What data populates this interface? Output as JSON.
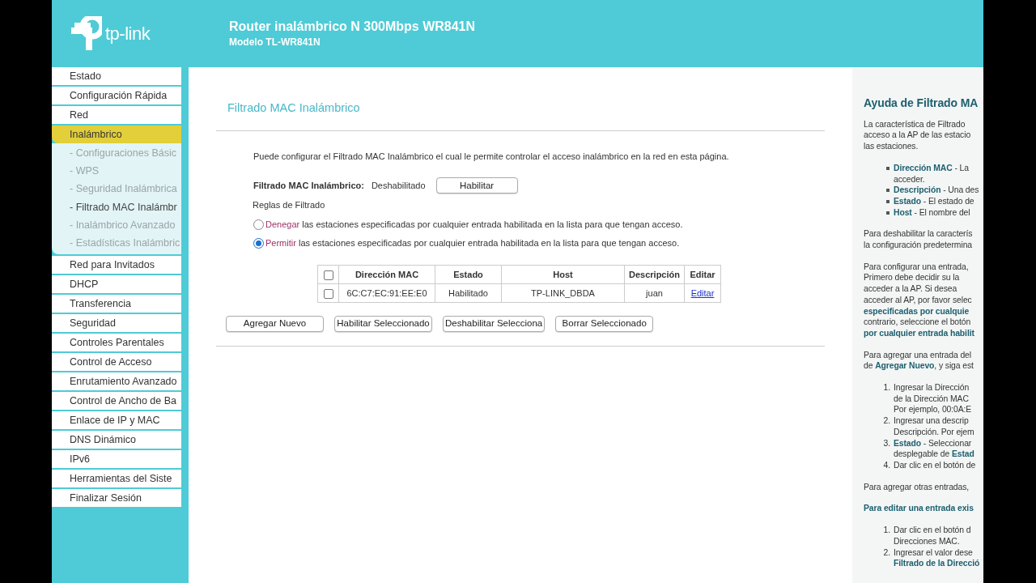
{
  "header": {
    "logo_text": "tp-link",
    "title": "Router inalámbrico N 300Mbps WR841N",
    "subtitle": "Modelo TL-WR841N"
  },
  "sidebar": {
    "items": [
      {
        "label": "Estado",
        "selected": false
      },
      {
        "label": "Configuración Rápida",
        "selected": false
      },
      {
        "label": "Red",
        "selected": false
      },
      {
        "label": "Inalámbrico",
        "selected": true,
        "children": [
          {
            "label": "- Configuraciones Básic",
            "selected": false
          },
          {
            "label": "- WPS",
            "selected": false
          },
          {
            "label": "- Seguridad Inalámbrica",
            "selected": false
          },
          {
            "label": "- Filtrado MAC Inalámbr",
            "selected": true
          },
          {
            "label": "- Inalámbrico Avanzado",
            "selected": false
          },
          {
            "label": "- Estadísticas Inalámbric",
            "selected": false
          }
        ]
      },
      {
        "label": "Red para Invitados",
        "selected": false
      },
      {
        "label": "DHCP",
        "selected": false
      },
      {
        "label": "Transferencia",
        "selected": false
      },
      {
        "label": "Seguridad",
        "selected": false
      },
      {
        "label": "Controles Parentales",
        "selected": false
      },
      {
        "label": "Control de Acceso",
        "selected": false
      },
      {
        "label": "Enrutamiento Avanzado",
        "selected": false
      },
      {
        "label": "Control de Ancho de Ba",
        "selected": false
      },
      {
        "label": "Enlace de IP y MAC",
        "selected": false
      },
      {
        "label": "DNS Dinámico",
        "selected": false
      },
      {
        "label": "IPv6",
        "selected": false
      },
      {
        "label": "Herramientas del Siste",
        "selected": false
      },
      {
        "label": "Finalizar Sesión",
        "selected": false
      }
    ]
  },
  "content": {
    "title": "Filtrado MAC Inalámbrico",
    "description": "Puede configurar el Filtrado MAC Inalámbrico el cual le permite controlar el acceso inalámbrico en la red en esta página.",
    "status": {
      "label": "Filtrado MAC Inalámbrico:",
      "value": "Deshabilitado",
      "button": "Habilitar"
    },
    "rules_label": "Reglas de Filtrado",
    "rules": [
      {
        "keyword": "Denegar",
        "text": "las estaciones especificadas por cualquier entrada habilitada en la lista para que tengan acceso.",
        "selected": false
      },
      {
        "keyword": "Permitir",
        "text": "las estaciones especificadas por cualquier entrada habilitada en la lista para que tengan acceso.",
        "selected": true
      }
    ],
    "table": {
      "select_all_checked": false,
      "columns": [
        "Dirección MAC",
        "Estado",
        "Host",
        "Descripción",
        "Editar"
      ],
      "rows": [
        {
          "checked": false,
          "mac": "6C:C7:EC:91:EE:E0",
          "estado": "Habilitado",
          "host": "TP-LINK_DBDA",
          "descripcion": "juan",
          "edit_link": "Editar"
        }
      ]
    },
    "buttons": [
      "Agregar Nuevo",
      "Habilitar Seleccionado",
      "Deshabilitar Selecciona",
      "Borrar Seleccionado"
    ]
  },
  "help": {
    "title": "Ayuda de Filtrado MA",
    "blocks": [
      {
        "kind": "p",
        "lines": [
          "La característica de Filtrado",
          "acceso a la AP de las estacio",
          "las estaciones."
        ]
      },
      {
        "kind": "ul",
        "items": [
          [
            "**Dirección MAC** - La",
            "acceder."
          ],
          [
            "**Descripción** - Una des"
          ],
          [
            "**Estado** - El estado de"
          ],
          [
            "**Host** - El nombre del"
          ]
        ]
      },
      {
        "kind": "p",
        "lines": [
          "Para deshabilitar la caracterís",
          "la configuración predetermina"
        ]
      },
      {
        "kind": "p",
        "lines": [
          "Para configurar una entrada,",
          "Primero debe decidir su la",
          "acceder a la AP. Si desea",
          "acceder al AP, por favor selec",
          "**especificadas por cualquie**",
          "contrario, seleccione el botón",
          "**por cualquier entrada habilit**"
        ]
      },
      {
        "kind": "p",
        "lines": [
          "Para agregar una entrada del",
          "de **Agregar Nuevo**, y siga est"
        ]
      },
      {
        "kind": "ol",
        "items": [
          {
            "num": "1.",
            "lines": [
              "Ingresar la Dirección",
              "de la Dirección MAC",
              "Por ejemplo, 00:0A:E"
            ]
          },
          {
            "num": "2.",
            "lines": [
              "Ingresar una descrip",
              "Descripción. Por ejem"
            ]
          },
          {
            "num": "3.",
            "lines": [
              "**Estado** - Seleccionar",
              "desplegable de **Estad**"
            ]
          },
          {
            "num": "4.",
            "lines": [
              "Dar clic en el botón de"
            ]
          }
        ]
      },
      {
        "kind": "p",
        "lines": [
          "Para agregar otras entradas,"
        ]
      },
      {
        "kind": "h",
        "lines": [
          "Para editar una entrada exis"
        ]
      },
      {
        "kind": "ol",
        "items": [
          {
            "num": "1.",
            "lines": [
              "Dar clic en el botón d",
              "Direcciones MAC."
            ]
          },
          {
            "num": "2.",
            "lines": [
              "Ingresar el valor dese",
              "**Filtrado de la Direcció**"
            ]
          }
        ]
      }
    ]
  }
}
